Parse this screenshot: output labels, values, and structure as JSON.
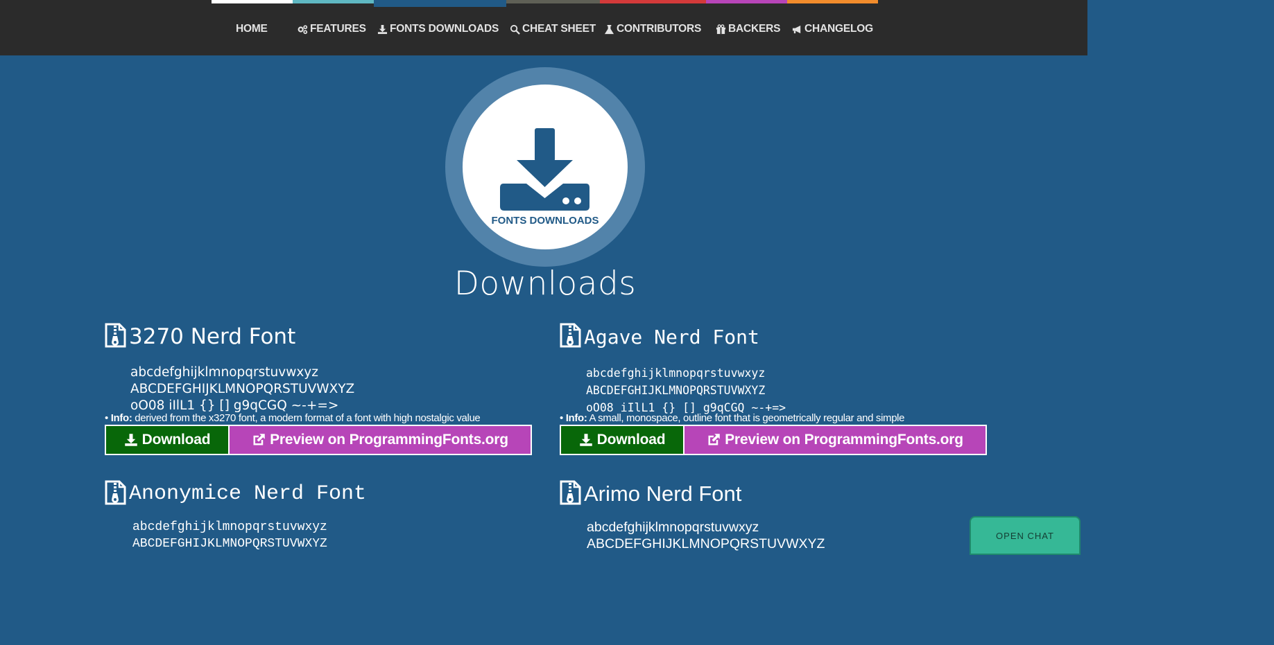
{
  "nav": {
    "stripes": [
      "#ffffff",
      "#5fb8c2",
      "#215a87",
      "#5f6056",
      "#d33a3a",
      "#b745b8",
      "#f28c2c"
    ],
    "items": [
      {
        "label": "HOME",
        "icon": "none"
      },
      {
        "label": "FEATURES",
        "icon": "gears-icon"
      },
      {
        "label": "FONTS DOWNLOADS",
        "icon": "download-icon"
      },
      {
        "label": "CHEAT SHEET",
        "icon": "search-icon"
      },
      {
        "label": "CONTRIBUTORS",
        "icon": "flask-icon"
      },
      {
        "label": "BACKERS",
        "icon": "gift-icon"
      },
      {
        "label": "CHANGELOG",
        "icon": "bullhorn-icon"
      }
    ]
  },
  "hero": {
    "label": "FONTS DOWNLOADS",
    "title": "Downloads"
  },
  "fonts": [
    {
      "name": "3270 Nerd Font",
      "sample_lower": "abcdefghijklmnopqrstuvwxyz",
      "sample_upper": "ABCDEFGHIJKLMNOPQRSTUVWXYZ",
      "sample_symbols": "oO08 iIlL1 {} [] g9qCGQ ~-+=>",
      "info_label": "Info:",
      "info_text": "derived from the x3270 font, a modern format of a font with high nostalgic value",
      "download_label": "Download",
      "preview_label": "Preview on ProgrammingFonts.org"
    },
    {
      "name": "Agave Nerd Font",
      "sample_lower": "abcdefghijklmnopqrstuvwxyz",
      "sample_upper": "ABCDEFGHIJKLMNOPQRSTUVWXYZ",
      "sample_symbols": "oO08 iIlL1 {} [] g9qCGQ ~-+=>",
      "info_label": "Info:",
      "info_text": "A small, monospace, outline font that is geometrically regular and simple",
      "download_label": "Download",
      "preview_label": "Preview on ProgrammingFonts.org"
    },
    {
      "name": "Anonymice Nerd Font",
      "sample_lower": "abcdefghijklmnopqrstuvwxyz",
      "sample_upper": "ABCDEFGHIJKLMNOPQRSTUVWXYZ"
    },
    {
      "name": "Arimo Nerd Font",
      "sample_lower": "abcdefghijklmnopqrstuvwxyz",
      "sample_upper": "ABCDEFGHIJKLMNOPQRSTUVWXYZ"
    }
  ],
  "chat": {
    "label": "OPEN CHAT"
  }
}
